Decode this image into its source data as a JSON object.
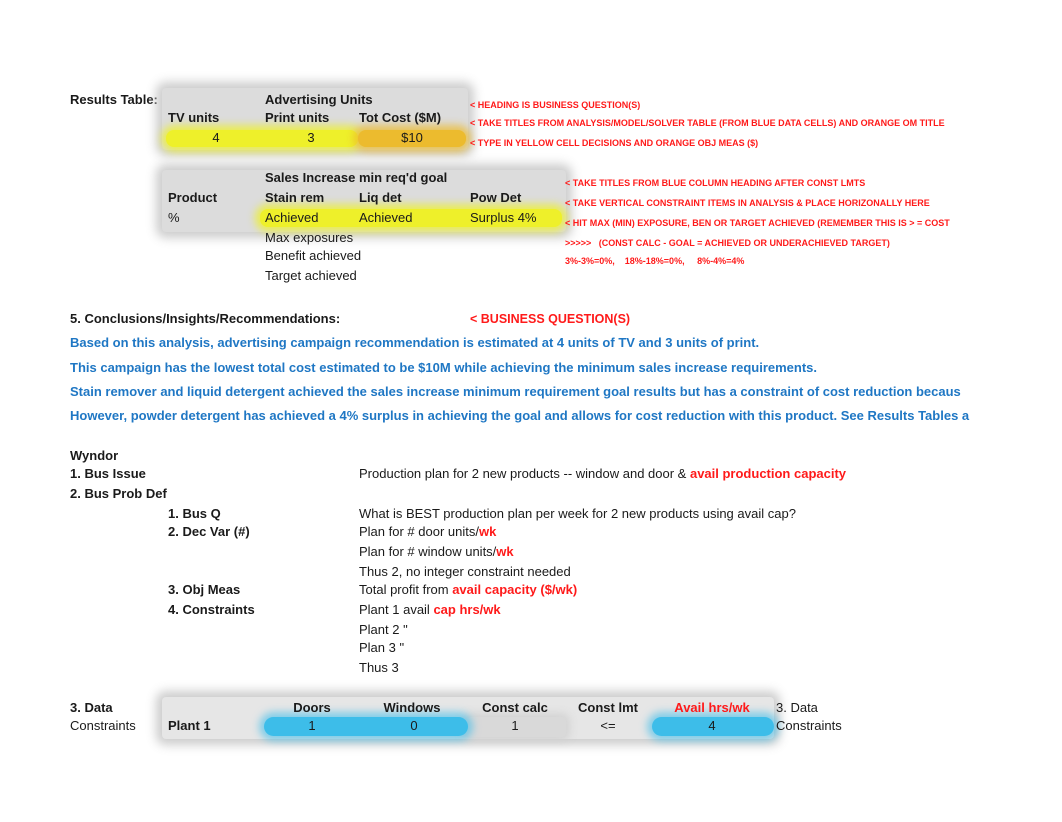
{
  "results_table": {
    "label": "Results Table:",
    "advertising": {
      "group_heading": "Advertising Units",
      "headers": [
        "TV units",
        "Print units",
        "Tot Cost ($M)"
      ],
      "values": [
        "4",
        "3",
        "$10"
      ]
    },
    "sales": {
      "group_heading": "Sales Increase min req'd goal",
      "row_header": "Product",
      "headers": [
        "Stain rem",
        "Liq det",
        "Pow Det"
      ],
      "row_label": "%",
      "values": [
        "Achieved",
        "Achieved",
        "Surplus 4%"
      ],
      "legend": [
        "Max exposures",
        "Benefit achieved",
        "Target achieved"
      ]
    },
    "notes": [
      "< HEADING IS BUSINESS QUESTION(S)",
      "< TAKE TITLES FROM ANALYSIS/MODEL/SOLVER TABLE (FROM BLUE DATA CELLS) AND ORANGE OM TITLE",
      "< TYPE IN YELLOW CELL DECISIONS AND ORANGE OBJ MEAS ($)",
      "< TAKE TITLES FROM BLUE COLUMN HEADING AFTER CONST LMTS",
      "< TAKE VERTICAL CONSTRAINT ITEMS IN ANALYSIS & PLACE HORIZONALLY HERE",
      "< HIT MAX (MIN) EXPOSURE, BEN OR TARGET ACHIEVED (REMEMBER THIS IS > = COST",
      ">>>>>   (CONST CALC - GOAL = ACHIEVED OR UNDERACHIEVED TARGET)",
      "3%-3%=0%,    18%-18%=0%,     8%-4%=4%"
    ]
  },
  "conclusions": {
    "heading": "5.  Conclusions/Insights/Recommendations:",
    "note": "< BUSINESS QUESTION(S)",
    "lines": [
      "Based on this analysis, advertising campaign recommendation is estimated at 4 units of TV and 3 units of print.",
      "This campaign has the lowest total cost estimated to be $10M while achieving the minimum sales increase requirements.",
      "Stain remover and liquid detergent achieved the sales increase minimum requirement goal results but has a constraint of cost reduction becaus",
      "However, powder detergent has achieved a 4% surplus in achieving the goal and allows for cost reduction with this product. See Results Tables a"
    ]
  },
  "wyndor": {
    "title": "Wyndor",
    "bus_issue": {
      "label": "1.  Bus Issue",
      "text": "Production plan for 2 new products -- window and door & ",
      "text_red": "avail production capacity"
    },
    "bus_prob_def": {
      "label": "2. Bus Prob Def"
    },
    "bus_q": {
      "label": "1. Bus Q",
      "text": "What is BEST production plan per week for 2 new products using avail cap?"
    },
    "dec_var": {
      "label": "2. Dec Var (#)",
      "line1": "Plan for # door units/",
      "line1_red": "wk",
      "line2": "Plan for # window units/",
      "line2_red": "wk",
      "line3": "Thus 2, no integer constraint needed"
    },
    "obj_meas": {
      "label": "3. Obj Meas",
      "text": "Total profit from ",
      "text_red": "avail capacity ($/wk)"
    },
    "constraints": {
      "label": "4. Constraints",
      "line1": "Plant 1 avail ",
      "line1_red": "cap hrs/wk",
      "line2": "Plant 2 \"",
      "line3": "Plan 3 \"",
      "line4": "Thus 3"
    }
  },
  "data_table": {
    "section_label": "3. Data",
    "row_group_label": "Constraints",
    "headers": [
      "Doors",
      "Windows",
      "Const calc",
      "Const lmt",
      "Avail hrs/wk"
    ],
    "right_label_1": "3. Data",
    "right_label_2": "Constraints",
    "rows": [
      {
        "name": "Plant 1",
        "doors": "1",
        "windows": "0",
        "const_calc": "1",
        "const_lmt": "<=",
        "avail": "4"
      }
    ]
  },
  "colors": {
    "decision_yellow": "#eef02a",
    "objective_orange": "#ecbb2e",
    "data_blue": "#3dbde9",
    "note_red": "#ff1a1a",
    "conclusion_blue": "#1f77c4"
  }
}
